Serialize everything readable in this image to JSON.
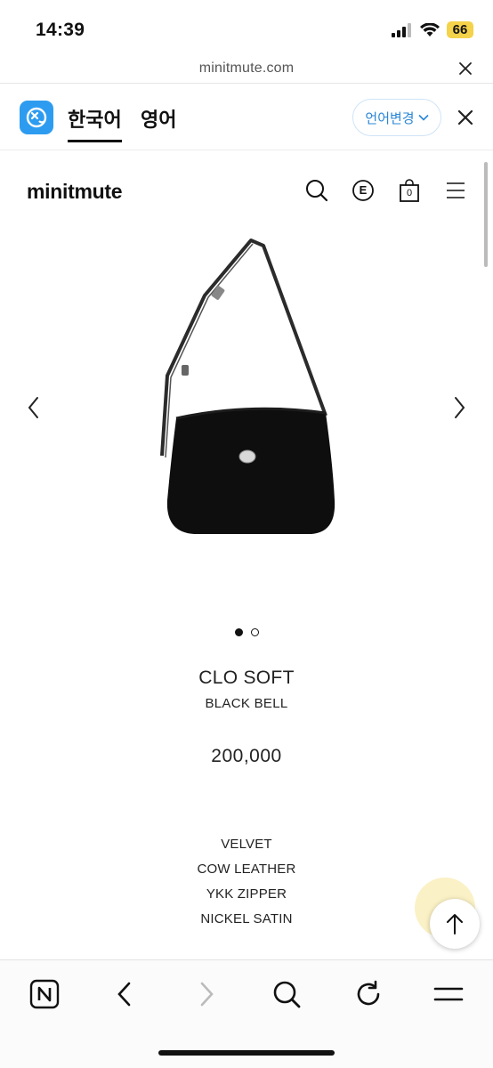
{
  "status_bar": {
    "time": "14:39",
    "battery": "66"
  },
  "browser": {
    "url": "minitmute.com"
  },
  "translator": {
    "tabs": [
      {
        "label": "한국어",
        "active": true
      },
      {
        "label": "영어",
        "active": false
      }
    ],
    "change_language_label": "언어변경"
  },
  "site": {
    "brand": "minitmute",
    "cart_count": "0",
    "currency_icon_letter": "E"
  },
  "carousel": {
    "slide_count": 2,
    "active_index": 0
  },
  "product": {
    "name": "CLO SOFT",
    "color": "BLACK BELL",
    "price": "200,000",
    "materials": [
      "VELVET",
      "COW LEATHER",
      "YKK ZIPPER",
      "NICKEL SATIN"
    ]
  },
  "icons": {
    "search": "search-icon",
    "currency": "currency-e-icon",
    "cart": "shopping-bag-icon",
    "menu": "hamburger-menu-icon"
  }
}
